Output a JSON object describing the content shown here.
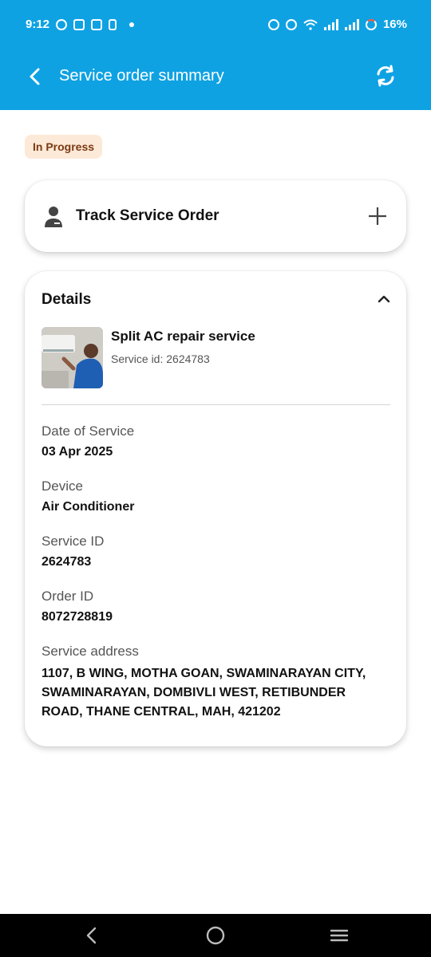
{
  "status_bar": {
    "time": "9:12",
    "battery": "16%"
  },
  "app_bar": {
    "title": "Service order summary",
    "back_icon": "back-arrow-icon",
    "refresh_icon": "refresh-icon"
  },
  "status_badge": "In Progress",
  "track_card": {
    "label": "Track Service Order",
    "icon": "person-icon",
    "action_icon": "plus-icon"
  },
  "details": {
    "heading": "Details",
    "service_name": "Split AC repair service",
    "service_id_line": "Service id: 2624783",
    "fields": [
      {
        "label": "Date of Service",
        "value": "03 Apr 2025"
      },
      {
        "label": "Device",
        "value": "Air Conditioner"
      },
      {
        "label": "Service ID",
        "value": "2624783"
      },
      {
        "label": "Order ID",
        "value": "8072728819"
      },
      {
        "label": "Service address",
        "value": "1107, B WING, MOTHA GOAN, SWAMINARAYAN CITY, SWAMINARAYAN, DOMBIVLI WEST, RETIBUNDER ROAD, THANE CENTRAL, MAH, 421202"
      }
    ]
  },
  "colors": {
    "app_bar": "#0fa2e3",
    "badge_bg": "#fde9d7",
    "badge_text": "#7a3b13"
  }
}
